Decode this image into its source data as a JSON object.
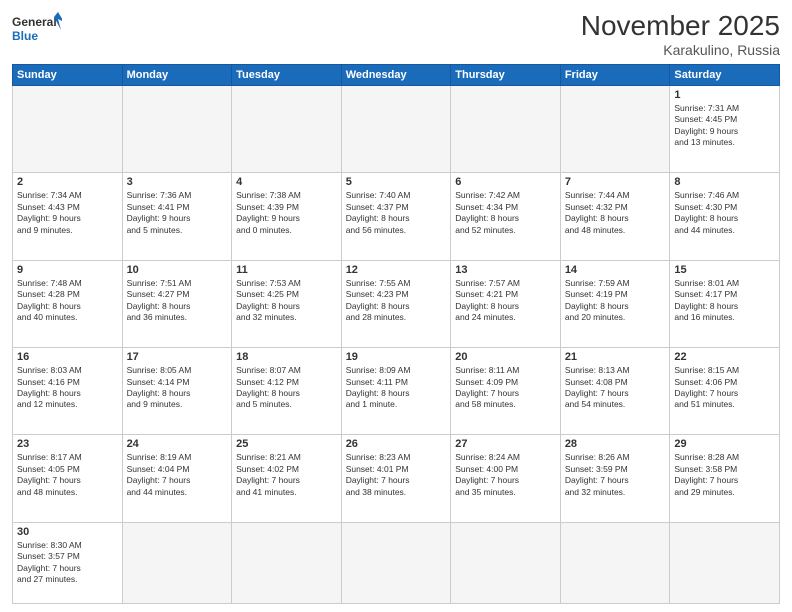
{
  "header": {
    "logo_general": "General",
    "logo_blue": "Blue",
    "month_title": "November 2025",
    "location": "Karakulino, Russia"
  },
  "weekdays": [
    "Sunday",
    "Monday",
    "Tuesday",
    "Wednesday",
    "Thursday",
    "Friday",
    "Saturday"
  ],
  "weeks": [
    [
      {
        "day": "",
        "info": "",
        "empty": true
      },
      {
        "day": "",
        "info": "",
        "empty": true
      },
      {
        "day": "",
        "info": "",
        "empty": true
      },
      {
        "day": "",
        "info": "",
        "empty": true
      },
      {
        "day": "",
        "info": "",
        "empty": true
      },
      {
        "day": "",
        "info": "",
        "empty": true
      },
      {
        "day": "1",
        "info": "Sunrise: 7:31 AM\nSunset: 4:45 PM\nDaylight: 9 hours\nand 13 minutes."
      }
    ],
    [
      {
        "day": "2",
        "info": "Sunrise: 7:34 AM\nSunset: 4:43 PM\nDaylight: 9 hours\nand 9 minutes."
      },
      {
        "day": "3",
        "info": "Sunrise: 7:36 AM\nSunset: 4:41 PM\nDaylight: 9 hours\nand 5 minutes."
      },
      {
        "day": "4",
        "info": "Sunrise: 7:38 AM\nSunset: 4:39 PM\nDaylight: 9 hours\nand 0 minutes."
      },
      {
        "day": "5",
        "info": "Sunrise: 7:40 AM\nSunset: 4:37 PM\nDaylight: 8 hours\nand 56 minutes."
      },
      {
        "day": "6",
        "info": "Sunrise: 7:42 AM\nSunset: 4:34 PM\nDaylight: 8 hours\nand 52 minutes."
      },
      {
        "day": "7",
        "info": "Sunrise: 7:44 AM\nSunset: 4:32 PM\nDaylight: 8 hours\nand 48 minutes."
      },
      {
        "day": "8",
        "info": "Sunrise: 7:46 AM\nSunset: 4:30 PM\nDaylight: 8 hours\nand 44 minutes."
      }
    ],
    [
      {
        "day": "9",
        "info": "Sunrise: 7:48 AM\nSunset: 4:28 PM\nDaylight: 8 hours\nand 40 minutes."
      },
      {
        "day": "10",
        "info": "Sunrise: 7:51 AM\nSunset: 4:27 PM\nDaylight: 8 hours\nand 36 minutes."
      },
      {
        "day": "11",
        "info": "Sunrise: 7:53 AM\nSunset: 4:25 PM\nDaylight: 8 hours\nand 32 minutes."
      },
      {
        "day": "12",
        "info": "Sunrise: 7:55 AM\nSunset: 4:23 PM\nDaylight: 8 hours\nand 28 minutes."
      },
      {
        "day": "13",
        "info": "Sunrise: 7:57 AM\nSunset: 4:21 PM\nDaylight: 8 hours\nand 24 minutes."
      },
      {
        "day": "14",
        "info": "Sunrise: 7:59 AM\nSunset: 4:19 PM\nDaylight: 8 hours\nand 20 minutes."
      },
      {
        "day": "15",
        "info": "Sunrise: 8:01 AM\nSunset: 4:17 PM\nDaylight: 8 hours\nand 16 minutes."
      }
    ],
    [
      {
        "day": "16",
        "info": "Sunrise: 8:03 AM\nSunset: 4:16 PM\nDaylight: 8 hours\nand 12 minutes."
      },
      {
        "day": "17",
        "info": "Sunrise: 8:05 AM\nSunset: 4:14 PM\nDaylight: 8 hours\nand 9 minutes."
      },
      {
        "day": "18",
        "info": "Sunrise: 8:07 AM\nSunset: 4:12 PM\nDaylight: 8 hours\nand 5 minutes."
      },
      {
        "day": "19",
        "info": "Sunrise: 8:09 AM\nSunset: 4:11 PM\nDaylight: 8 hours\nand 1 minute."
      },
      {
        "day": "20",
        "info": "Sunrise: 8:11 AM\nSunset: 4:09 PM\nDaylight: 7 hours\nand 58 minutes."
      },
      {
        "day": "21",
        "info": "Sunrise: 8:13 AM\nSunset: 4:08 PM\nDaylight: 7 hours\nand 54 minutes."
      },
      {
        "day": "22",
        "info": "Sunrise: 8:15 AM\nSunset: 4:06 PM\nDaylight: 7 hours\nand 51 minutes."
      }
    ],
    [
      {
        "day": "23",
        "info": "Sunrise: 8:17 AM\nSunset: 4:05 PM\nDaylight: 7 hours\nand 48 minutes."
      },
      {
        "day": "24",
        "info": "Sunrise: 8:19 AM\nSunset: 4:04 PM\nDaylight: 7 hours\nand 44 minutes."
      },
      {
        "day": "25",
        "info": "Sunrise: 8:21 AM\nSunset: 4:02 PM\nDaylight: 7 hours\nand 41 minutes."
      },
      {
        "day": "26",
        "info": "Sunrise: 8:23 AM\nSunset: 4:01 PM\nDaylight: 7 hours\nand 38 minutes."
      },
      {
        "day": "27",
        "info": "Sunrise: 8:24 AM\nSunset: 4:00 PM\nDaylight: 7 hours\nand 35 minutes."
      },
      {
        "day": "28",
        "info": "Sunrise: 8:26 AM\nSunset: 3:59 PM\nDaylight: 7 hours\nand 32 minutes."
      },
      {
        "day": "29",
        "info": "Sunrise: 8:28 AM\nSunset: 3:58 PM\nDaylight: 7 hours\nand 29 minutes."
      }
    ],
    [
      {
        "day": "30",
        "info": "Sunrise: 8:30 AM\nSunset: 3:57 PM\nDaylight: 7 hours\nand 27 minutes."
      },
      {
        "day": "",
        "info": "",
        "empty": true
      },
      {
        "day": "",
        "info": "",
        "empty": true
      },
      {
        "day": "",
        "info": "",
        "empty": true
      },
      {
        "day": "",
        "info": "",
        "empty": true
      },
      {
        "day": "",
        "info": "",
        "empty": true
      },
      {
        "day": "",
        "info": "",
        "empty": true
      }
    ]
  ]
}
